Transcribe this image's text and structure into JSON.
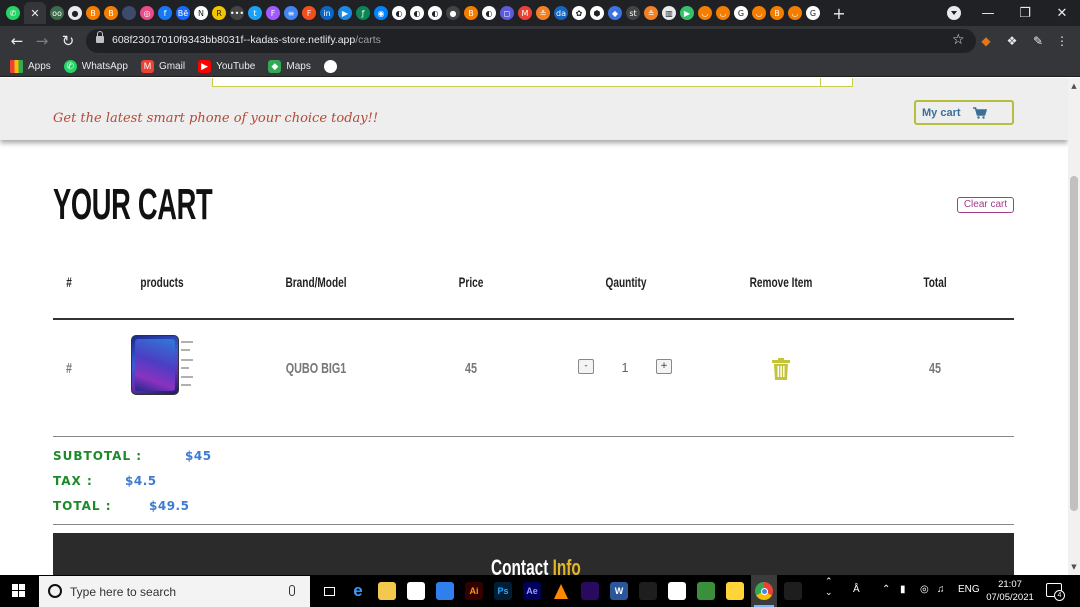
{
  "browser": {
    "tab_icons": [
      {
        "name": "whatsapp-icon",
        "color": "#25d366",
        "glyph": "✆"
      },
      {
        "name": "odoo-icon",
        "color": "#3d6b4b",
        "glyph": "oo"
      },
      {
        "name": "github-icon",
        "color": "#e8eaed",
        "glyph": "●"
      },
      {
        "name": "blogger-icon",
        "color": "#f57d00",
        "glyph": "B"
      },
      {
        "name": "blogger-icon",
        "color": "#f57d00",
        "glyph": "B"
      },
      {
        "name": "blank-tab-icon",
        "color": "#3c4a6b",
        "glyph": ""
      },
      {
        "name": "dribbble-icon",
        "color": "#ea4c89",
        "glyph": "◎"
      },
      {
        "name": "facebook-icon",
        "color": "#1877f2",
        "glyph": "f"
      },
      {
        "name": "behance-icon",
        "color": "#1769ff",
        "glyph": "Bē"
      },
      {
        "name": "notion-icon",
        "color": "#ffffff",
        "glyph": "N"
      },
      {
        "name": "replit-icon",
        "color": "#f5c400",
        "glyph": "R"
      },
      {
        "name": "medium-icon",
        "color": "#444444",
        "glyph": "•••"
      },
      {
        "name": "twitter-icon",
        "color": "#1da1f2",
        "glyph": "t"
      },
      {
        "name": "figma-icon",
        "color": "#a259ff",
        "glyph": "F"
      },
      {
        "name": "docs-icon",
        "color": "#4285f4",
        "glyph": "≡"
      },
      {
        "name": "figma-icon",
        "color": "#f24e1e",
        "glyph": "F"
      },
      {
        "name": "linkedin-icon",
        "color": "#0a66c2",
        "glyph": "in"
      },
      {
        "name": "video-icon",
        "color": "#1e88e5",
        "glyph": "▶"
      },
      {
        "name": "freecodecamp-icon",
        "color": "#0a8754",
        "glyph": "ƒ"
      },
      {
        "name": "messenger-icon",
        "color": "#0084ff",
        "glyph": "◉"
      },
      {
        "name": "globe-icon",
        "color": "#ffffff",
        "glyph": "◐"
      },
      {
        "name": "globe-icon",
        "color": "#ffffff",
        "glyph": "◐"
      },
      {
        "name": "globe-icon",
        "color": "#ffffff",
        "glyph": "◐"
      },
      {
        "name": "github-icon",
        "color": "#444444",
        "glyph": "●"
      },
      {
        "name": "blogger-icon",
        "color": "#f57d00",
        "glyph": "B"
      },
      {
        "name": "globe-icon",
        "color": "#ffffff",
        "glyph": "◐"
      },
      {
        "name": "instagram-icon",
        "color": "#5b5bdb",
        "glyph": "◻"
      },
      {
        "name": "gmail-icon",
        "color": "#ea4335",
        "glyph": "M"
      },
      {
        "name": "stack-overflow-icon",
        "color": "#f48024",
        "glyph": "≗"
      },
      {
        "name": "dev-icon",
        "color": "#1565c0",
        "glyph": "da"
      },
      {
        "name": "openai-icon",
        "color": "#ffffff",
        "glyph": "✿"
      },
      {
        "name": "cube-icon",
        "color": "#ffffff",
        "glyph": "⬢"
      },
      {
        "name": "shield-icon",
        "color": "#3b73e0",
        "glyph": "◆"
      },
      {
        "name": "st-icon",
        "color": "#444444",
        "glyph": "st"
      },
      {
        "name": "stack-overflow-icon",
        "color": "#f48024",
        "glyph": "≗"
      },
      {
        "name": "books-icon",
        "color": "#e8eaed",
        "glyph": "▥"
      },
      {
        "name": "play-icon",
        "color": "#35c26a",
        "glyph": "▶"
      },
      {
        "name": "smile-icon",
        "color": "#f57d00",
        "glyph": "◡"
      },
      {
        "name": "smile-icon",
        "color": "#f57d00",
        "glyph": "◡"
      },
      {
        "name": "google-icon",
        "color": "#ffffff",
        "glyph": "G"
      },
      {
        "name": "smile-icon",
        "color": "#f57d00",
        "glyph": "◡"
      },
      {
        "name": "blogger-icon",
        "color": "#f57d00",
        "glyph": "B"
      },
      {
        "name": "smile-icon",
        "color": "#f57d00",
        "glyph": "◡"
      },
      {
        "name": "google-icon",
        "color": "#ffffff",
        "glyph": "G"
      }
    ],
    "active_tab_close": "✕",
    "new_tab": "+",
    "window_controls": {
      "minimize": "—",
      "restore": "❐",
      "close": "✕"
    },
    "url_host": "608f23017010f9343bb8031f--kadas-store.netlify.app",
    "url_path": "/carts",
    "bookmarks": [
      {
        "name": "apps",
        "label": "Apps",
        "color": "#ea4335"
      },
      {
        "name": "whatsapp",
        "label": "WhatsApp",
        "color": "#25d366"
      },
      {
        "name": "gmail",
        "label": "Gmail",
        "color": "#ea4335"
      },
      {
        "name": "youtube",
        "label": "YouTube",
        "color": "#ff0000"
      },
      {
        "name": "maps",
        "label": "Maps",
        "color": "#34a853"
      },
      {
        "name": "globe",
        "label": "",
        "color": "#ffffff"
      }
    ]
  },
  "page": {
    "tagline": "Get the latest smart phone of your choice today!!",
    "my_cart_label": "My cart",
    "title": "YOUR CART",
    "clear_cart_label": "Clear cart",
    "columns": [
      "#",
      "products",
      "Brand/Model",
      "Price",
      "Qauntity",
      "Remove Item",
      "Total"
    ],
    "items": [
      {
        "index": "#",
        "model": "QUBO BIG1",
        "price": "45",
        "quantity": "1",
        "total": "45",
        "decrement": "-",
        "increment": "+"
      }
    ],
    "summary": {
      "subtotal_label": "SUBTOTAL :",
      "subtotal_value": "$45",
      "tax_label": "TAX :",
      "tax_value": "$4.5",
      "total_label": "TOTAL :",
      "total_value": "$49.5"
    },
    "footer_title": "Contact",
    "footer_accent": "Info"
  },
  "colors": {
    "tagline": "#b24a39",
    "accent_green": "#1c8a2a",
    "accent_blue": "#3e7bd3",
    "trash": "#c3c43a",
    "clear_cart": "#a33c8a",
    "footer_accent": "#e2b428"
  },
  "taskbar": {
    "search_placeholder": "Type here to search",
    "apps": [
      {
        "name": "task-view-icon",
        "label": "",
        "bg": "transparent",
        "fg": "#ffffff"
      },
      {
        "name": "edge-icon",
        "label": "e",
        "bg": "transparent",
        "fg": "#3b9cff"
      },
      {
        "name": "file-explorer-icon",
        "label": "",
        "bg": "#f2c94c",
        "fg": "#000"
      },
      {
        "name": "store-icon",
        "label": "",
        "bg": "#ffffff",
        "fg": "#000"
      },
      {
        "name": "mail-icon",
        "label": "",
        "bg": "#2f80ed",
        "fg": "#fff"
      },
      {
        "name": "illustrator-icon",
        "label": "Ai",
        "bg": "#330000",
        "fg": "#ff9a00"
      },
      {
        "name": "photoshop-icon",
        "label": "Ps",
        "bg": "#001e36",
        "fg": "#31a8ff"
      },
      {
        "name": "after-effects-icon",
        "label": "Ae",
        "bg": "#00005b",
        "fg": "#9999ff"
      },
      {
        "name": "vlc-icon",
        "label": "",
        "bg": "transparent",
        "fg": "#ff8800"
      },
      {
        "name": "premiere-icon",
        "label": "",
        "bg": "#2a0a5e",
        "fg": "#fff"
      },
      {
        "name": "word-icon",
        "label": "W",
        "bg": "#2b579a",
        "fg": "#fff"
      },
      {
        "name": "figma-taskbar-icon",
        "label": "",
        "bg": "#1e1e1e",
        "fg": "#fff"
      },
      {
        "name": "slack-icon",
        "label": "",
        "bg": "#ffffff",
        "fg": "#000"
      },
      {
        "name": "control-panel-icon",
        "label": "",
        "bg": "#3a8f3a",
        "fg": "#fff"
      },
      {
        "name": "python-icon",
        "label": "",
        "bg": "#ffd43b",
        "fg": "#000"
      },
      {
        "name": "chrome-icon",
        "label": "",
        "bg": "transparent",
        "fg": "#fff"
      },
      {
        "name": "terminal-icon",
        "label": "",
        "bg": "#1e1e1e",
        "fg": "#fff"
      }
    ],
    "tray_lang": "ENG",
    "time": "21:07",
    "date": "07/05/2021",
    "notification_count": "4"
  }
}
